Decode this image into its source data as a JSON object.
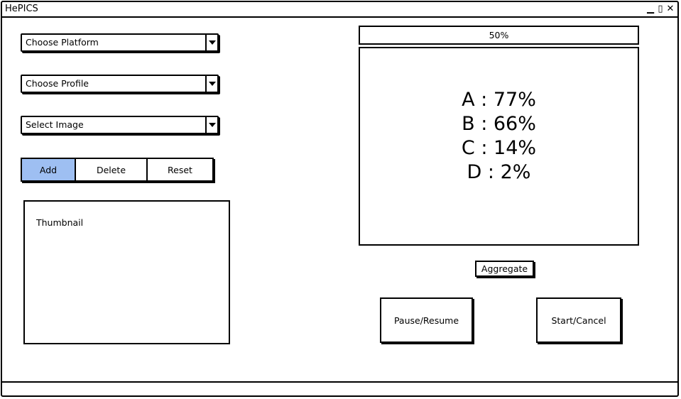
{
  "window": {
    "title": "HePICS",
    "controls": [
      "minimize-icon",
      "maximize-icon",
      "close-icon"
    ]
  },
  "left_panel": {
    "platform_dropdown": {
      "label": "Choose Platform"
    },
    "profile_dropdown": {
      "label": "Choose Profile"
    },
    "image_dropdown": {
      "label": "Select Image"
    },
    "buttons": {
      "add": "Add",
      "delete": "Delete",
      "reset": "Reset"
    },
    "thumbnail": {
      "label": "Thumbnail"
    }
  },
  "right_panel": {
    "progress": {
      "label": "50%"
    },
    "results": [
      {
        "text": "A : 77%"
      },
      {
        "text": "B : 66%"
      },
      {
        "text": "C : 14%"
      },
      {
        "text": "D : 2%"
      }
    ],
    "aggregate_label": "Aggregate",
    "pause_resume_label": "Pause/Resume",
    "start_cancel_label": "Start/Cancel"
  },
  "colors": {
    "selected_segment": "#9ebff2",
    "border": "#000000",
    "background": "#ffffff"
  }
}
